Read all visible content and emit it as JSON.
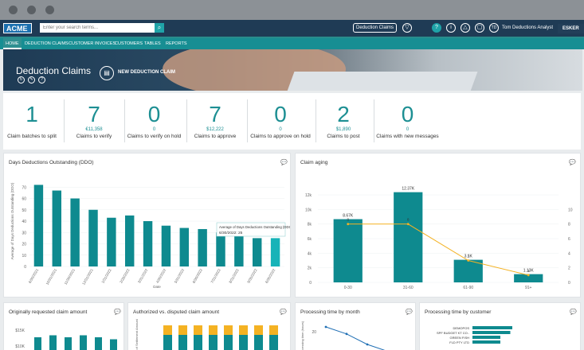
{
  "header": {
    "logo": "ACME",
    "search_placeholder": "Enter your search terms...",
    "search_button": "⌕",
    "selector": "Deduction Claims",
    "icons": [
      "filter-icon",
      "help-icon",
      "info-icon",
      "bell-icon",
      "lock-icon",
      "avatar"
    ],
    "user_initials": "TD",
    "user_name": "Tom Deductions Analyst",
    "brand": "ESKER"
  },
  "nav": [
    "HOME",
    "DEDUCTION CLAIMS",
    "CUSTOMER INVOICES",
    "CUSTOMERS",
    "TABLES",
    "REPORTS"
  ],
  "hero": {
    "title": "Deduction Claims",
    "new_claim": "NEW DEDUCTION CLAIM",
    "icons": [
      "refresh-icon",
      "edit-icon",
      "help-icon"
    ]
  },
  "kpis": [
    {
      "value": "1",
      "sub": "",
      "label": "Claim batches to split"
    },
    {
      "value": "7",
      "sub": "€11,358",
      "label": "Claims to verify"
    },
    {
      "value": "0",
      "sub": "0",
      "label": "Claims to verify on hold"
    },
    {
      "value": "7",
      "sub": "$12,222",
      "label": "Claims to approve"
    },
    {
      "value": "0",
      "sub": "0",
      "label": "Claims to approve on hold"
    },
    {
      "value": "2",
      "sub": "$1,890",
      "label": "Claims to post"
    },
    {
      "value": "0",
      "sub": "0",
      "label": "Claims with new messages"
    }
  ],
  "cards": {
    "ddo": "Days Deductions Outstanding (DDO)",
    "aging": "Claim aging",
    "orig": "Originally requested claim amount",
    "auth": "Authorized vs. disputed claim amount",
    "ptime_month": "Processing time by month",
    "ptime_cust": "Processing time by customer"
  },
  "chart_data": [
    {
      "type": "bar",
      "title": "Days Deductions Outstanding (DDO)",
      "xlabel": "Date",
      "ylabel": "Average of Days Deductions Outstanding (DDO)",
      "ylim": [
        0,
        80
      ],
      "yticks": [
        0,
        10,
        20,
        30,
        40,
        50,
        60,
        70
      ],
      "categories": [
        "6/30/2021",
        "10/31/2021",
        "11/30/2021",
        "12/31/2021",
        "1/31/2022",
        "2/28/2022",
        "3/31/2022",
        "4/30/2022",
        "5/31/2022",
        "6/30/2022",
        "7/31/2022",
        "8/31/2022",
        "9/30/2022",
        "6/30/2022"
      ],
      "values": [
        72,
        67,
        60,
        50,
        43,
        45,
        40,
        36,
        34,
        33,
        30,
        29,
        25,
        25
      ],
      "tooltip": {
        "title": "Average of Days Deductions Outstanding (DDO)",
        "line": "6/30/2022: 25"
      }
    },
    {
      "type": "bar",
      "title": "Claim aging",
      "categories": [
        "0-30",
        "31-60",
        "61-90",
        "91+"
      ],
      "values": [
        8670,
        12370,
        3100,
        1130
      ],
      "data_labels": [
        "8.67K",
        "12.37K",
        "3.1K",
        "1.13K"
      ],
      "ylim": [
        0,
        12000
      ],
      "yticks": [
        "0",
        "2k",
        "4k",
        "6k",
        "8k",
        "10k",
        "12k"
      ],
      "line": {
        "values": [
          8,
          8,
          3,
          1
        ]
      },
      "y2ticks": [
        "0",
        "2",
        "4",
        "6",
        "8",
        "10"
      ]
    },
    {
      "type": "bar",
      "title": "Originally requested claim amount",
      "yticks": [
        "$15K",
        "$10K"
      ],
      "values": [
        14,
        15,
        14,
        15,
        14,
        13
      ]
    },
    {
      "type": "bar",
      "title": "Authorized vs. disputed claim amount",
      "ylabel": "Sum of Settlement Amount",
      "series": [
        {
          "name": "Authorized",
          "values": [
            6,
            6,
            6,
            6,
            6,
            6,
            6,
            6
          ]
        },
        {
          "name": "Disputed",
          "values": [
            3,
            3,
            3,
            3,
            3,
            3,
            3,
            3
          ]
        }
      ]
    },
    {
      "type": "line",
      "title": "Processing time by month",
      "ylabel": "Processing time (hours)",
      "yticks": [
        "20"
      ],
      "values": [
        20,
        16,
        10,
        6
      ]
    },
    {
      "type": "bar",
      "title": "Processing time by customer",
      "categories": [
        "DEMOPOS",
        "SPF BUDGET KT CO..",
        "GREEN FISH",
        "FLD PTY LTD"
      ],
      "values": [
        40,
        38,
        28,
        28
      ]
    }
  ]
}
